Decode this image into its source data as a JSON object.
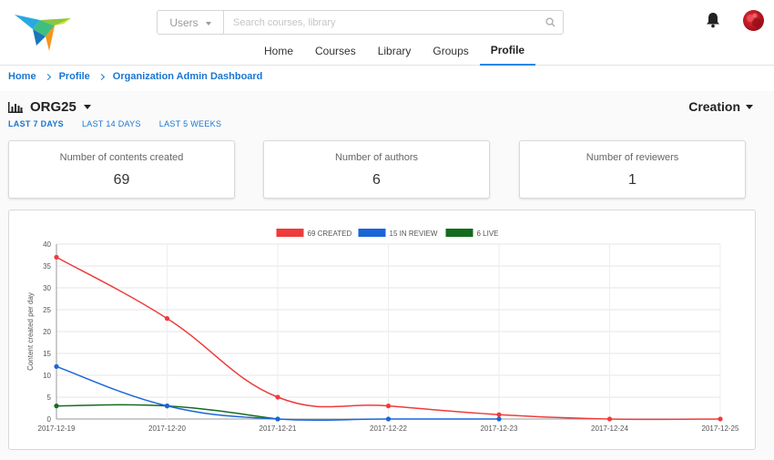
{
  "header": {
    "search": {
      "scope": "Users",
      "placeholder": "Search courses, library"
    },
    "nav": [
      {
        "label": "Home",
        "active": false
      },
      {
        "label": "Courses",
        "active": false
      },
      {
        "label": "Library",
        "active": false
      },
      {
        "label": "Groups",
        "active": false
      },
      {
        "label": "Profile",
        "active": true
      }
    ]
  },
  "breadcrumb": [
    "Home",
    "Profile",
    "Organization Admin Dashboard"
  ],
  "dashboard": {
    "org": "ORG25",
    "view_selector": "Creation",
    "periods": [
      {
        "label": "LAST 7 DAYS",
        "active": true
      },
      {
        "label": "LAST 14 DAYS",
        "active": false
      },
      {
        "label": "LAST 5 WEEKS",
        "active": false
      }
    ],
    "stats": [
      {
        "label": "Number of contents created",
        "value": "69"
      },
      {
        "label": "Number of authors",
        "value": "6"
      },
      {
        "label": "Number of reviewers",
        "value": "1"
      }
    ]
  },
  "chart_data": {
    "type": "line",
    "ylabel": "Content created per day",
    "xlabel": "",
    "ylim": [
      0,
      40
    ],
    "yticks": [
      0,
      5,
      10,
      15,
      20,
      25,
      30,
      35,
      40
    ],
    "x": [
      "2017-12-19",
      "2017-12-20",
      "2017-12-21",
      "2017-12-22",
      "2017-12-23",
      "2017-12-24",
      "2017-12-25"
    ],
    "legend_position": "top-center",
    "grid": true,
    "series": [
      {
        "name": "69 CREATED",
        "color": "#ef3b3b",
        "values": [
          37,
          23,
          5,
          3,
          1,
          0,
          0
        ]
      },
      {
        "name": "15 IN REVIEW",
        "color": "#1a66d9",
        "values": [
          12,
          3,
          0,
          0,
          0,
          null,
          null
        ]
      },
      {
        "name": "6 LIVE",
        "color": "#146c1e",
        "values": [
          3,
          3,
          0,
          null,
          null,
          null,
          null
        ]
      }
    ]
  }
}
